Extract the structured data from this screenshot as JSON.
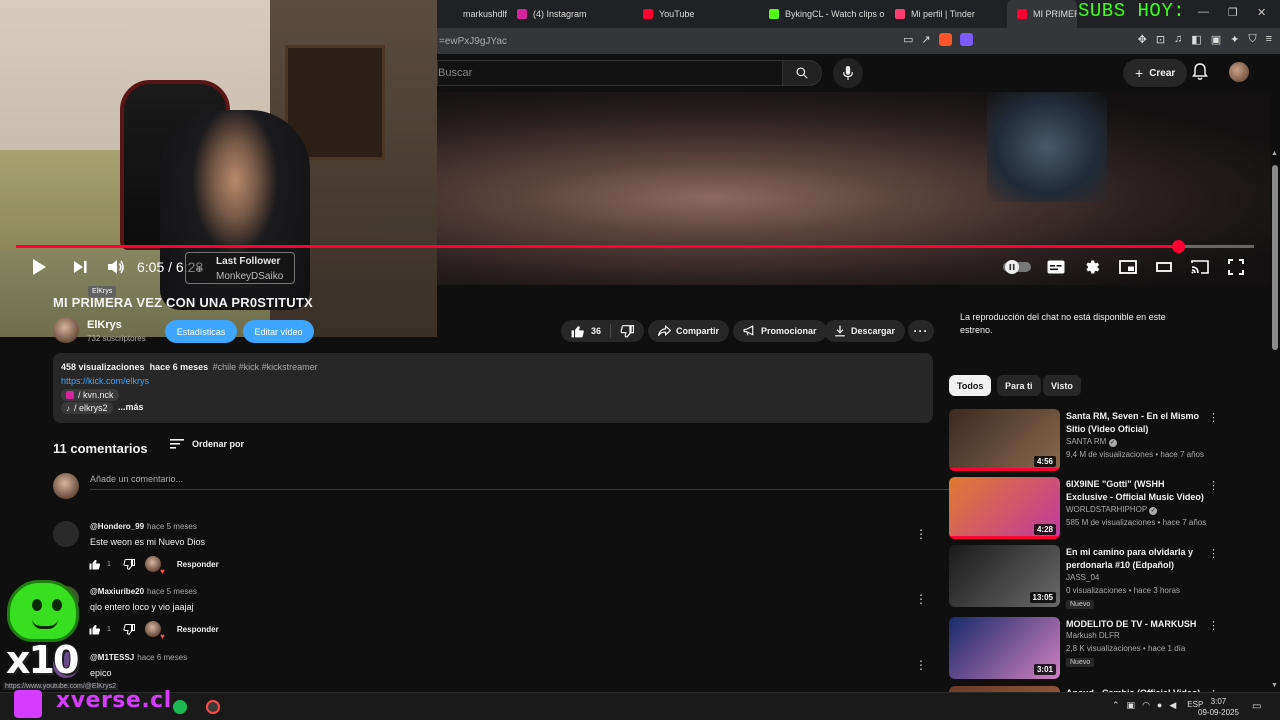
{
  "browser": {
    "tabs": [
      {
        "label": "markushdlfr cu #m",
        "favicon_color": "#202124"
      },
      {
        "label": "(4) Instagram",
        "favicon_color": "#d6249f"
      },
      {
        "label": "YouTube",
        "favicon_color": "#ff0033"
      },
      {
        "label": "BykingCL - Watch clips on",
        "favicon_color": "#53fc18"
      },
      {
        "label": "Mi perfil | Tinder",
        "favicon_color": "#fe3c72"
      },
      {
        "label": "MI PRIMERA VEZ C",
        "favicon_color": "#ff0033"
      }
    ],
    "url": "=ewPxJ9gJYac",
    "overlay_text": "SUBS HOY:"
  },
  "masthead": {
    "search_placeholder": "Buscar",
    "create_label": "Crear"
  },
  "player": {
    "time_current": "6:05",
    "time_total": "6:28",
    "progress_fraction": 0.939,
    "last_follower_label": "Last Follower",
    "last_follower_name": "MonkeyDSaiko",
    "tooltip": "ElKrys"
  },
  "video": {
    "title": "MI PRIMERA VEZ CON UNA PR0STITUTX",
    "channel": "ElKrys",
    "subscribers": "732 suscriptores",
    "btn_stats": "Estadísticas",
    "btn_edit": "Editar vídeo",
    "likes": "36",
    "share": "Compartir",
    "promote": "Promocionar",
    "download": "Descargar"
  },
  "description": {
    "views": "458 visualizaciones",
    "ago": "hace 6 meses",
    "tags": "#chile #kick #kickstreamer",
    "link": "https://kick.com/elkrys",
    "chip1": "/ kvn.nck",
    "chip2": "/ elkrys2",
    "more": "...más"
  },
  "comments": {
    "count_label": "11 comentarios",
    "sort_label": "Ordenar por",
    "add_placeholder": "Añade un comentario...",
    "reply_label": "Responder",
    "items": [
      {
        "author": "@Hondero_99",
        "time": "hace 5 meses",
        "text": "Este weon es mi Nuevo Dios",
        "likes": "1",
        "avatar_color": "#2a2a2a"
      },
      {
        "author": "@Maxiuribe20",
        "time": "hace 5 meses",
        "text": "qlo entero loco y vio jaajaj",
        "likes": "1",
        "avatar_color": "#3a5a2a"
      },
      {
        "author": "@M1TESSJ",
        "time": "hace 6 meses",
        "text": "epico",
        "likes": "",
        "avatar_color": "#6a4a8a"
      }
    ]
  },
  "sidebar": {
    "chat_note": "La reproducción del chat no está disponible en este estreno.",
    "chips": [
      "Todos",
      "Para ti",
      "Visto"
    ],
    "recommendations": [
      {
        "title": "Santa RM, Seven - En el Mismo Sitio (Video Oficial)",
        "channel": "SANTA RM",
        "verified": true,
        "meta": "9,4 M de visualizaciones • hace 7 años",
        "duration": "4:56",
        "badge": "",
        "watched": true,
        "thumb_a": "#3a2a20",
        "thumb_b": "#8a6a50"
      },
      {
        "title": "6IX9INE \"Gotti\" (WSHH Exclusive - Official Music Video)",
        "channel": "WORLDSTARHIPHOP",
        "verified": true,
        "meta": "585 M de visualizaciones • hace 7 años",
        "duration": "4:28",
        "badge": "",
        "watched": true,
        "thumb_a": "#e07a30",
        "thumb_b": "#c03aa0"
      },
      {
        "title": "En mi camino para olvidarla y perdonarla #10 (Edpañol)",
        "channel": "JASS_04",
        "verified": false,
        "meta": "0 visualizaciones • hace 3 horas",
        "duration": "13:05",
        "badge": "Nuevo",
        "watched": false,
        "thumb_a": "#1a1a1a",
        "thumb_b": "#6a6a6a"
      },
      {
        "title": "MODELITO DE TV - MARKUSH",
        "channel": "Markush DLFR",
        "verified": false,
        "meta": "2,8 K visualizaciones • hace 1 día",
        "duration": "3:01",
        "badge": "Nuevo",
        "watched": false,
        "thumb_a": "#1a2a6a",
        "thumb_b": "#d080c0"
      },
      {
        "title": "Ancud - Cambia (Official Video)",
        "channel": "",
        "verified": false,
        "meta": "",
        "duration": "",
        "badge": "",
        "watched": false,
        "thumb_a": "#6a3a2a",
        "thumb_b": "#a06040"
      }
    ]
  },
  "overlays": {
    "multiplier": "x10",
    "brand": "xverse.cl",
    "status_url": "https://www.youtube.com/@ElKrys2"
  },
  "taskbar": {
    "lang": "ESP",
    "time": "3:07",
    "date": "09-09-2025"
  }
}
